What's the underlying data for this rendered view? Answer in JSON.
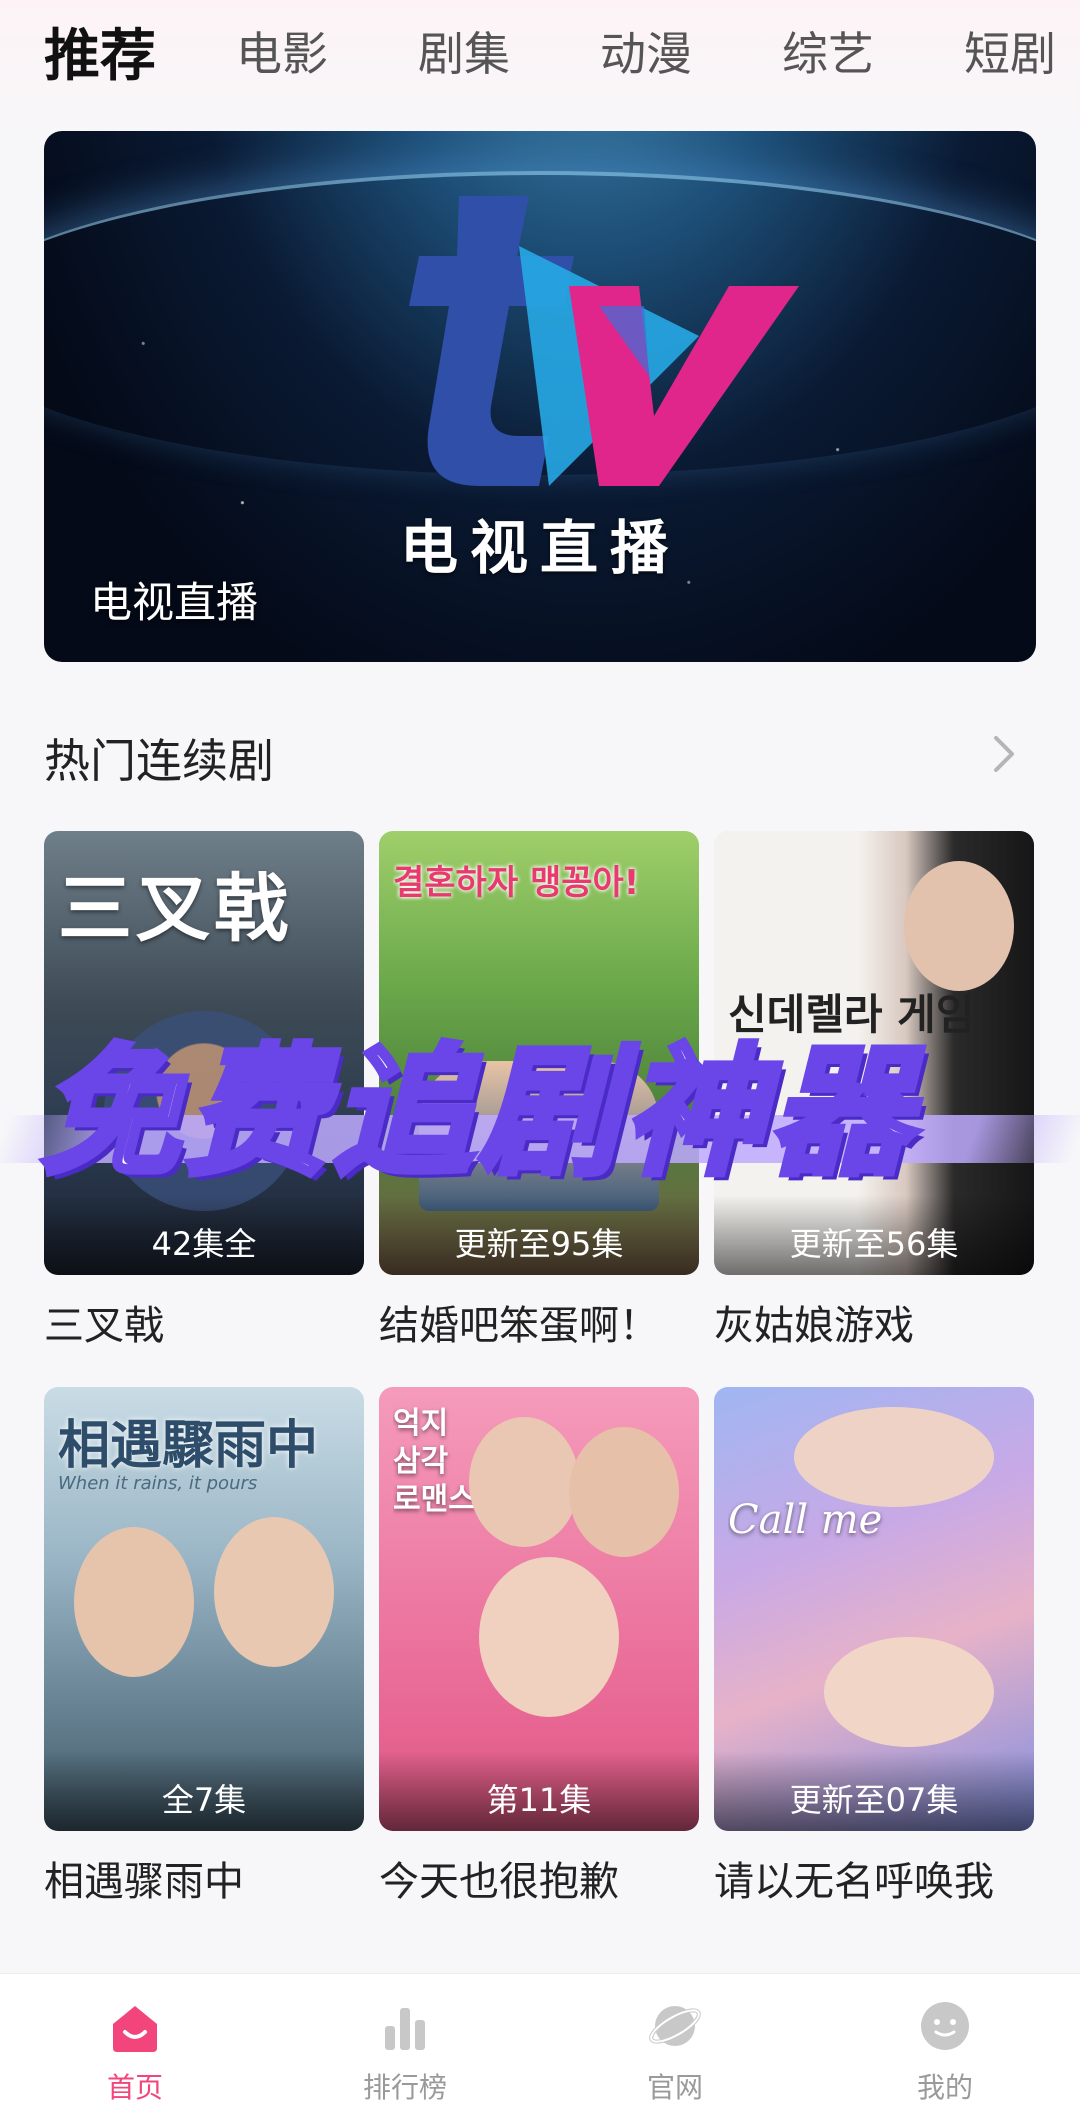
{
  "top_tabs": [
    {
      "label": "推荐",
      "active": true
    },
    {
      "label": "电影",
      "active": false
    },
    {
      "label": "剧集",
      "active": false
    },
    {
      "label": "动漫",
      "active": false
    },
    {
      "label": "综艺",
      "active": false
    },
    {
      "label": "短剧",
      "active": false
    }
  ],
  "banner": {
    "logo_text": "tv",
    "center_title": "电视直播",
    "label": "电视直播"
  },
  "section": {
    "title": "热门连续剧",
    "more_icon": "chevron-right-icon"
  },
  "shows": [
    {
      "title": "三叉戟",
      "episodes": "42集全",
      "poster_text": "三叉戟"
    },
    {
      "title": "结婚吧笨蛋啊！",
      "episodes": "更新至95集",
      "poster_text": "결혼하자 맹꽁아!"
    },
    {
      "title": "灰姑娘游戏",
      "episodes": "更新至56集",
      "poster_text": "신데렐라 게임"
    },
    {
      "title": "相遇骤雨中",
      "episodes": "全7集",
      "poster_text": "相遇驟雨中",
      "poster_subtext": "When it rains, it pours"
    },
    {
      "title": "今天也很抱歉",
      "episodes": "第11集",
      "poster_text": "억지 삼각 로맨스"
    },
    {
      "title": "请以无名呼唤我",
      "episodes": "更新至07集",
      "poster_text": "Call me"
    }
  ],
  "overlay_promo": "免费追剧神器",
  "bottom_nav": [
    {
      "label": "首页",
      "icon": "home-icon",
      "active": true
    },
    {
      "label": "排行榜",
      "icon": "bar-chart-icon",
      "active": false
    },
    {
      "label": "官网",
      "icon": "planet-icon",
      "active": false
    },
    {
      "label": "我的",
      "icon": "profile-face-icon",
      "active": false
    }
  ],
  "colors": {
    "accent": "#f2457c",
    "promo_stroke": "#6a45e8",
    "nav_inactive": "#c8c8c8"
  }
}
